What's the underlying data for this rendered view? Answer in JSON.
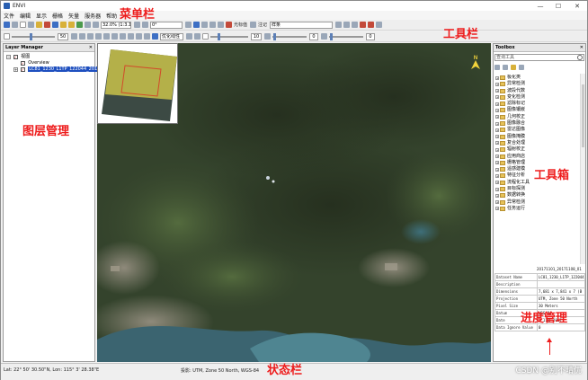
{
  "window": {
    "title": "ENVI",
    "controls": {
      "minimize": "—",
      "maximize": "☐",
      "close": "✕"
    }
  },
  "menubar": {
    "items": [
      "文件",
      "编辑",
      "显示",
      "栅格",
      "矢量",
      "服务器",
      "帮助"
    ]
  },
  "toolbar1": {
    "scale": "32.0% (1:3.1",
    "rotation": "0°",
    "cursor_value": "光标值",
    "annotation": "注记",
    "layer_select": "样条"
  },
  "toolbar2": {
    "stretch": "优化线性",
    "brightness": "50",
    "contrast": "10",
    "sharpen": "0"
  },
  "annotations": {
    "menubar": "菜单栏",
    "toolbar": "工具栏",
    "layer_manager": "图层管理",
    "toolbox": "工具箱",
    "status_bar": "状态栏",
    "progress_manager": "进度管理"
  },
  "layer_manager": {
    "title": "Layer Manager",
    "root": "视图",
    "overview": "Overview",
    "layer": "LC81_1230_L1TP_122044_2017"
  },
  "toolbox": {
    "title": "Toolbox",
    "search_placeholder": "查询工具",
    "items": [
      "极化类",
      "异常检测",
      "波段代数",
      "变化检测",
      "滤除标记",
      "图像镶嵌",
      "几何校正",
      "图像融合",
      "雷达图像",
      "图像掩膜",
      "复合处理",
      "辐射校正",
      "应用商店",
      "栅格管理",
      "遥感建模",
      "特征分析",
      "流程化工具",
      "目标探测",
      "数据转换",
      "异常检测",
      "任务运行"
    ]
  },
  "metadata": {
    "title": "20171101_20171108_01",
    "rows": [
      {
        "key": "Dataset Name",
        "value": "LC81_1230_L1TP_122044"
      },
      {
        "key": "Description",
        "value": ""
      },
      {
        "key": "Dimensions",
        "value": "7,681 x 7,841 x 7 (B"
      },
      {
        "key": "Projection",
        "value": "UTM, Zone 50 North"
      },
      {
        "key": "Pixel Size",
        "value": "30 Meters"
      },
      {
        "key": "Datum",
        "value": "WGS-84"
      },
      {
        "key": "Date",
        "value": "1 11月 2017"
      },
      {
        "key": "Data Ignore Value",
        "value": "0"
      }
    ]
  },
  "statusbar": {
    "location": "Lat: 22° 50' 30.50\"N, Lon: 115° 3' 28.38\"E",
    "projection": "投影: UTM, Zone 50 North, WGS-84"
  },
  "watermark": "CSDN @别不晴优",
  "colors": {
    "annotation": "#ee1c1c",
    "selection": "#1e4fbf",
    "folder": "#e6c25a"
  }
}
